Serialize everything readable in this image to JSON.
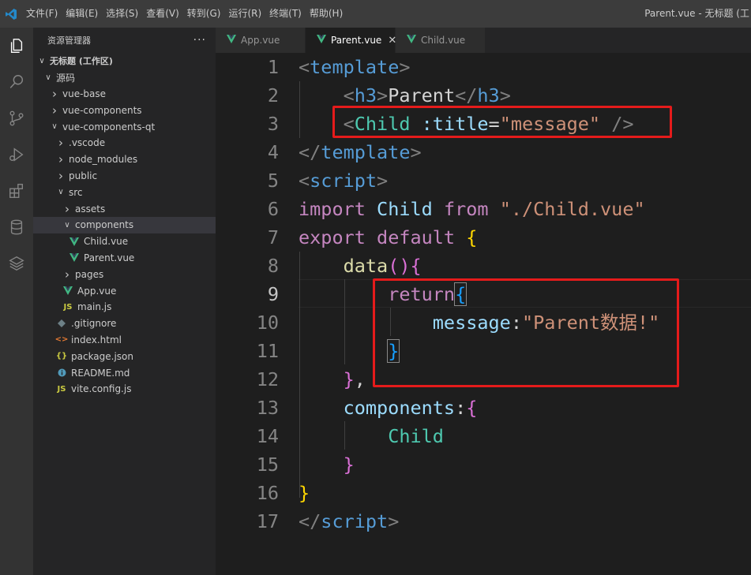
{
  "titlebar": {
    "menu": [
      "文件(F)",
      "编辑(E)",
      "选择(S)",
      "查看(V)",
      "转到(G)",
      "运行(R)",
      "终端(T)",
      "帮助(H)"
    ],
    "window_title": "Parent.vue - 无标题 (工"
  },
  "activitybar": {
    "icons": [
      "explorer-icon",
      "search-icon",
      "source-control-icon",
      "run-debug-icon",
      "extensions-icon",
      "database-icon",
      "layers-icon"
    ]
  },
  "sidebar": {
    "title": "资源管理器",
    "more": "···",
    "workspace": "无标题 (工作区)",
    "tree": [
      {
        "label": "源码",
        "indent": 1,
        "chevron": "open",
        "icon": ""
      },
      {
        "label": "vue-base",
        "indent": 2,
        "chevron": "closed",
        "icon": ""
      },
      {
        "label": "vue-components",
        "indent": 2,
        "chevron": "closed",
        "icon": ""
      },
      {
        "label": "vue-components-qt",
        "indent": 2,
        "chevron": "open",
        "icon": ""
      },
      {
        "label": ".vscode",
        "indent": 3,
        "chevron": "closed",
        "icon": ""
      },
      {
        "label": "node_modules",
        "indent": 3,
        "chevron": "closed",
        "icon": ""
      },
      {
        "label": "public",
        "indent": 3,
        "chevron": "closed",
        "icon": ""
      },
      {
        "label": "src",
        "indent": 3,
        "chevron": "open",
        "icon": ""
      },
      {
        "label": "assets",
        "indent": 4,
        "chevron": "closed",
        "icon": ""
      },
      {
        "label": "components",
        "indent": 4,
        "chevron": "open",
        "icon": "",
        "selected": true
      },
      {
        "label": "Child.vue",
        "indent": 5,
        "chevron": "",
        "icon": "vue"
      },
      {
        "label": "Parent.vue",
        "indent": 5,
        "chevron": "",
        "icon": "vue"
      },
      {
        "label": "pages",
        "indent": 4,
        "chevron": "closed",
        "icon": ""
      },
      {
        "label": "App.vue",
        "indent": 4,
        "chevron": "",
        "icon": "vue"
      },
      {
        "label": "main.js",
        "indent": 4,
        "chevron": "",
        "icon": "js"
      },
      {
        "label": ".gitignore",
        "indent": 3,
        "chevron": "",
        "icon": "git"
      },
      {
        "label": "index.html",
        "indent": 3,
        "chevron": "",
        "icon": "html"
      },
      {
        "label": "package.json",
        "indent": 3,
        "chevron": "",
        "icon": "json"
      },
      {
        "label": "README.md",
        "indent": 3,
        "chevron": "",
        "icon": "info"
      },
      {
        "label": "vite.config.js",
        "indent": 3,
        "chevron": "",
        "icon": "js"
      }
    ],
    "icon_glyphs": {
      "json": "{}",
      "js": "JS",
      "html": "<>"
    }
  },
  "tabs": [
    {
      "label": "App.vue",
      "active": false
    },
    {
      "label": "Parent.vue",
      "active": true,
      "close": "✕"
    },
    {
      "label": "Child.vue",
      "active": false
    }
  ],
  "editor": {
    "current_line": 9,
    "lines": [
      {
        "n": "1",
        "tokens": [
          [
            "t-gray",
            "<"
          ],
          [
            "t-blue",
            "template"
          ],
          [
            "t-gray",
            ">"
          ]
        ]
      },
      {
        "n": "2",
        "tokens": [
          [
            "",
            "    "
          ],
          [
            "t-gray",
            "<"
          ],
          [
            "t-blue",
            "h3"
          ],
          [
            "t-gray",
            ">"
          ],
          [
            "t-white",
            "Parent"
          ],
          [
            "t-gray",
            "</"
          ],
          [
            "t-blue",
            "h3"
          ],
          [
            "t-gray",
            ">"
          ]
        ]
      },
      {
        "n": "3",
        "tokens": [
          [
            "",
            "    "
          ],
          [
            "t-gray",
            "<"
          ],
          [
            "t-teal",
            "Child"
          ],
          [
            "t-white",
            " "
          ],
          [
            "t-lb",
            ":title"
          ],
          [
            "t-white",
            "="
          ],
          [
            "t-str",
            "\"message\""
          ],
          [
            "t-white",
            " "
          ],
          [
            "t-gray",
            "/>"
          ]
        ]
      },
      {
        "n": "4",
        "tokens": [
          [
            "t-gray",
            "</"
          ],
          [
            "t-blue",
            "template"
          ],
          [
            "t-gray",
            ">"
          ]
        ]
      },
      {
        "n": "5",
        "tokens": [
          [
            "t-gray",
            "<"
          ],
          [
            "t-blue",
            "script"
          ],
          [
            "t-gray",
            ">"
          ]
        ]
      },
      {
        "n": "6",
        "tokens": [
          [
            "t-pink",
            "import"
          ],
          [
            "t-white",
            " "
          ],
          [
            "t-lb",
            "Child"
          ],
          [
            "t-white",
            " "
          ],
          [
            "t-pink",
            "from"
          ],
          [
            "t-white",
            " "
          ],
          [
            "t-str",
            "\"./Child.vue\""
          ]
        ]
      },
      {
        "n": "7",
        "tokens": [
          [
            "t-pink",
            "export"
          ],
          [
            "t-white",
            " "
          ],
          [
            "t-pink",
            "default"
          ],
          [
            "t-white",
            " "
          ],
          [
            "t-gold",
            "{"
          ]
        ]
      },
      {
        "n": "8",
        "tokens": [
          [
            "",
            "    "
          ],
          [
            "t-yel",
            "data"
          ],
          [
            "t-mag",
            "()"
          ],
          [
            "t-mag",
            "{"
          ]
        ]
      },
      {
        "n": "9",
        "tokens": [
          [
            "",
            "        "
          ],
          [
            "t-pink",
            "return"
          ],
          [
            "t-br bracket-box",
            "{"
          ]
        ]
      },
      {
        "n": "10",
        "tokens": [
          [
            "",
            "            "
          ],
          [
            "t-lb",
            "message"
          ],
          [
            "t-white",
            ":"
          ],
          [
            "t-str",
            "\"Parent数据!\""
          ]
        ]
      },
      {
        "n": "11",
        "tokens": [
          [
            "",
            "        "
          ],
          [
            "t-br bracket-box",
            "}"
          ]
        ]
      },
      {
        "n": "12",
        "tokens": [
          [
            "",
            "    "
          ],
          [
            "t-mag",
            "}"
          ],
          [
            "t-white",
            ","
          ]
        ]
      },
      {
        "n": "13",
        "tokens": [
          [
            "",
            "    "
          ],
          [
            "t-lb",
            "components"
          ],
          [
            "t-white",
            ":"
          ],
          [
            "t-mag",
            "{"
          ]
        ]
      },
      {
        "n": "14",
        "tokens": [
          [
            "",
            "        "
          ],
          [
            "t-teal",
            "Child"
          ]
        ]
      },
      {
        "n": "15",
        "tokens": [
          [
            "",
            "    "
          ],
          [
            "t-mag",
            "}"
          ]
        ]
      },
      {
        "n": "16",
        "tokens": [
          [
            "t-gold",
            "}"
          ]
        ]
      },
      {
        "n": "17",
        "tokens": [
          [
            "t-gray",
            "</"
          ],
          [
            "t-blue",
            "script"
          ],
          [
            "t-gray",
            ">"
          ]
        ]
      }
    ]
  },
  "colors": {
    "highlight_box": "#e51b1b",
    "vue": "#41b883",
    "js": "#cbcb41",
    "json": "#cbcb41",
    "html": "#e37933",
    "git": "#6d8086",
    "info": "#519aba"
  }
}
